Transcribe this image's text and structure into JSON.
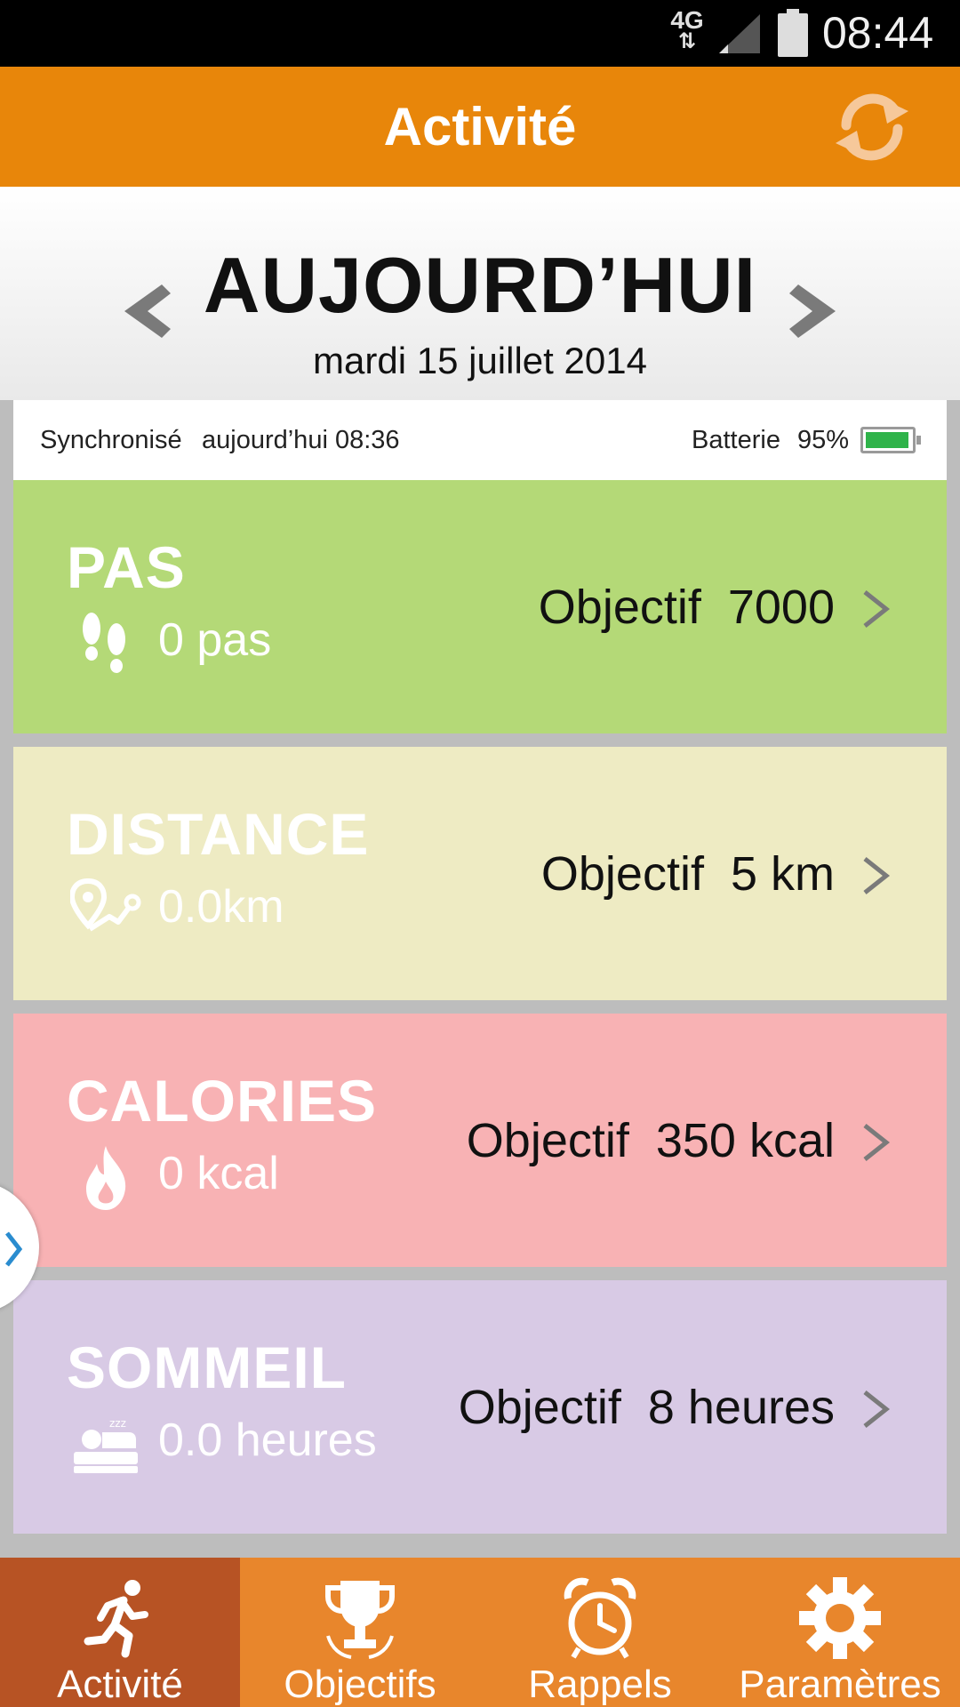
{
  "status_bar": {
    "network": "4G",
    "time": "08:44"
  },
  "app_bar": {
    "title": "Activité",
    "sync_icon": "sync-icon"
  },
  "date_nav": {
    "title": "AUJOURD’HUI",
    "date": "mardi 15 juillet 2014"
  },
  "sync_info": {
    "label": "Synchronisé",
    "value": "aujourd’hui 08:36",
    "battery_label": "Batterie",
    "battery_value": "95%",
    "battery_level": 0.95
  },
  "cards": [
    {
      "title": "PAS",
      "value": "0 pas",
      "goal_label": "Objectif",
      "goal_value": "7000",
      "icon": "footprints-icon",
      "color": "#b4d977"
    },
    {
      "title": "DISTANCE",
      "value": "0.0km",
      "goal_label": "Objectif",
      "goal_value": "5 km",
      "icon": "route-icon",
      "color": "#eeebc3"
    },
    {
      "title": "CALORIES",
      "value": "0 kcal",
      "goal_label": "Objectif",
      "goal_value": "350 kcal",
      "icon": "flame-icon",
      "color": "#f8b2b4"
    },
    {
      "title": "SOMMEIL",
      "value": "0.0 heures",
      "goal_label": "Objectif",
      "goal_value": "8 heures",
      "icon": "sleep-icon",
      "color": "#d8cae5"
    }
  ],
  "bottom_nav": [
    {
      "label": "Activité",
      "icon": "running-icon",
      "active": true
    },
    {
      "label": "Objectifs",
      "icon": "trophy-icon",
      "active": false
    },
    {
      "label": "Rappels",
      "icon": "alarm-clock-icon",
      "active": false
    },
    {
      "label": "Paramètres",
      "icon": "gear-icon",
      "active": false
    }
  ],
  "colors": {
    "accent": "#e8860a",
    "nav": "#e8862c",
    "nav_active": "#b75324",
    "battery": "#2fb34a"
  }
}
